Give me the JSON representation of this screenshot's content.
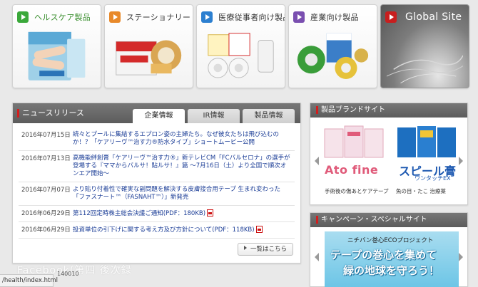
{
  "categories": [
    {
      "label": "ヘルスケア製品",
      "accent": "#3aa83a",
      "icon": "bandage-box-image"
    },
    {
      "label": "ステーショナリー",
      "accent": "#e8892a",
      "icon": "tape-box-image"
    },
    {
      "label": "医療従事者向け製品",
      "accent": "#2c7fd0",
      "icon": "medical-tape-image"
    },
    {
      "label": "産業向け製品",
      "accent": "#7a4fb0",
      "icon": "industrial-tape-image"
    },
    {
      "label": "Global Site",
      "accent": "#c81e1e",
      "icon": "globe-image"
    }
  ],
  "news": {
    "title": "ニュースリリース",
    "tabs": [
      "企業情報",
      "IR情報",
      "製品情報"
    ],
    "items": [
      {
        "date": "2016年07月15日",
        "text": "続々とプールに集結するエプロン姿の主婦たち。なぜ彼女たちは飛び込むのか！？「ケアリーヴ™治す力®防水タイプ」ショートムービー公開",
        "pdf": false
      },
      {
        "date": "2016年07月13日",
        "text": "高機能絆創膏「ケアリーヴ™治す力®」新テレビCM「FCバルセロナ」の選手が登場する『ママからバルサ！貼ルサ！』篇 〜7月16日（土）より全国で順次オンエア開始〜",
        "pdf": false
      },
      {
        "date": "2016年07月07日",
        "text": "より貼り付着性で確実な副問題を解決する皮膚接合用テープ 生まれ変わった「ファスナート™（FASNAHT™）」新発売",
        "pdf": false
      },
      {
        "date": "2016年06月29日",
        "text": "第112回定時株主総会決議ご通知(PDF：180KB)",
        "pdf": true
      },
      {
        "date": "2016年06月29日",
        "text": "投資単位の引下げに関する考え方及び方針について(PDF：118KB)",
        "pdf": true
      }
    ],
    "more_label": "一覧はこちら"
  },
  "overlay": {
    "facebook_text": "Facebook(第四 後次録",
    "number_text": "140010"
  },
  "status_bar": "/health/index.html",
  "brands": {
    "title": "製品ブランドサイト",
    "a_logo": "Ato fine",
    "a_sub": "手術後の傷あとケアテープ",
    "b_logo": "スピール膏",
    "b_logo2": "ワンタッチEX",
    "b_sub": "魚の目・たこ 治療薬"
  },
  "campaign": {
    "title": "キャンペーン・スペシャルサイト",
    "eco_top": "ニチバン巻心ECOプロジェクト",
    "eco_line1": "テープの巻心を集めて",
    "eco_line2": "緑の地球を守ろう！"
  }
}
